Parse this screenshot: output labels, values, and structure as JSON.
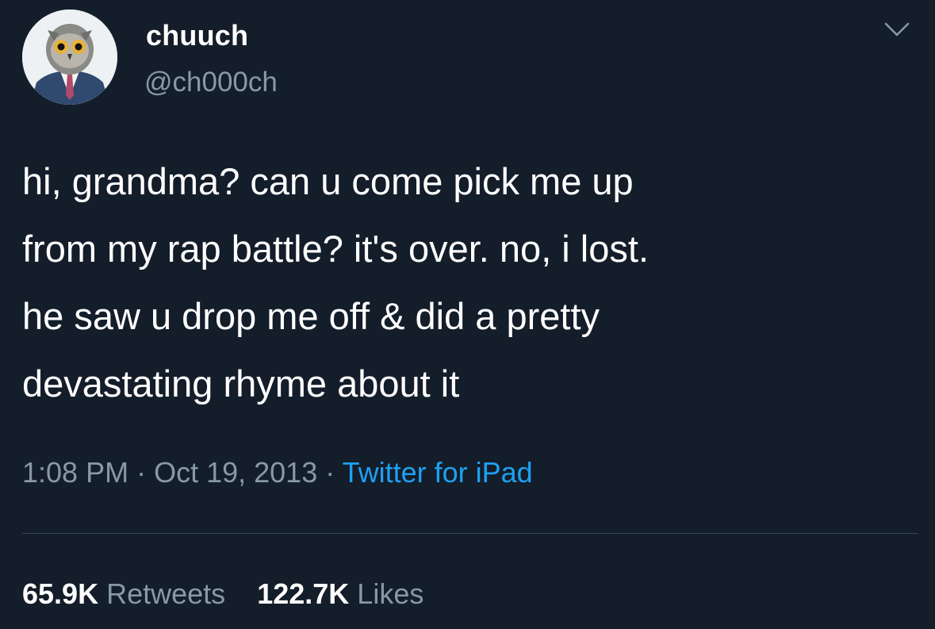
{
  "user": {
    "display_name": "chuuch",
    "handle": "@ch000ch",
    "avatar_icon": "owl-in-suit-avatar"
  },
  "menu_icon": "chevron-down-icon",
  "tweet": {
    "lines": [
      "hi, grandma? can u come pick me up",
      "from my rap battle? it's over. no, i lost.",
      "he saw u drop me off & did a pretty",
      "devastating rhyme about it"
    ]
  },
  "meta": {
    "time": "1:08 PM",
    "sep1": " · ",
    "date": "Oct 19, 2013",
    "sep2": " · ",
    "source": "Twitter for iPad"
  },
  "stats": {
    "retweets_count": "65.9K",
    "retweets_label": "Retweets",
    "likes_count": "122.7K",
    "likes_label": "Likes"
  },
  "colors": {
    "background": "#141d2a",
    "secondary_text": "#8899a6",
    "link": "#1da1f2",
    "divider": "#38444d"
  }
}
